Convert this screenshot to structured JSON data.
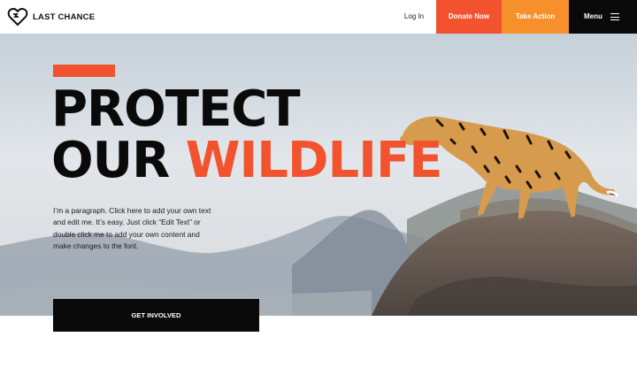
{
  "header": {
    "logo_text": "LAST CHANCE",
    "login_label": "Log In",
    "donate_label": "Donate Now",
    "action_label": "Take Action",
    "menu_label": "Menu"
  },
  "hero": {
    "headline_line1": "PROTECT",
    "headline_line2_a": "OUR",
    "headline_line2_b": "WILDLIFE",
    "paragraph": "I’m a paragraph. Click here to add your own text and edit me. It’s easy. Just click “Edit Text” or double click me to add your own content and make changes to the font.",
    "cta_label": "GET INVOLVED"
  },
  "colors": {
    "accent_orange": "#f2532e",
    "accent_amber": "#f7902a",
    "dark": "#0a0a0a"
  },
  "icons": [
    "heart-logo-icon",
    "hamburger-menu-icon"
  ]
}
